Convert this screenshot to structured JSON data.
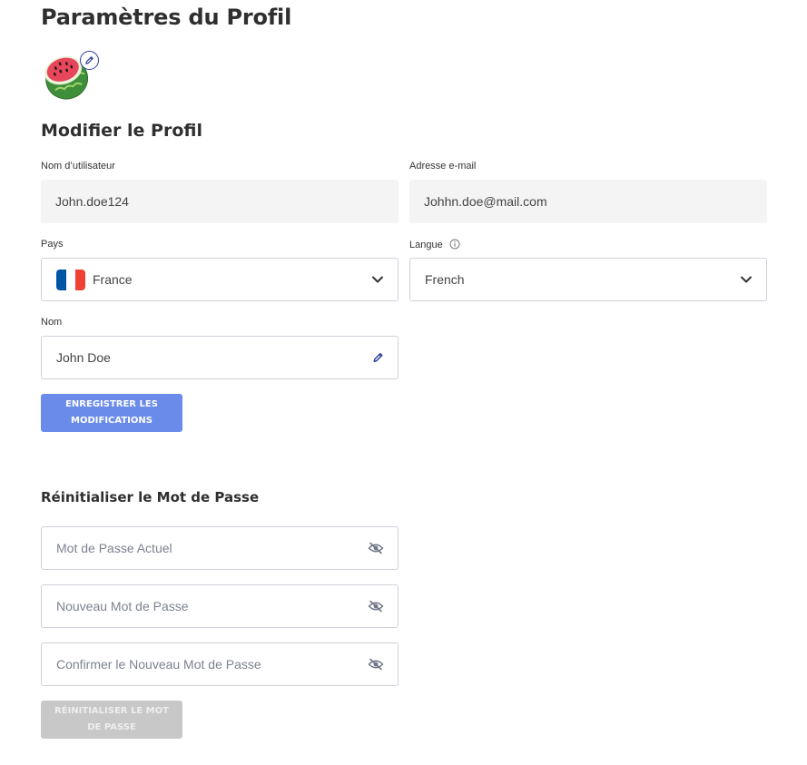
{
  "page": {
    "title": "Paramètres du Profil"
  },
  "profile": {
    "section_title": "Modifier le Profil",
    "username": {
      "label": "Nom d’utilisateur",
      "value": "John.doe124"
    },
    "email": {
      "label": "Adresse e-mail",
      "value": "Johhn.doe@mail.com"
    },
    "country": {
      "label": "Pays",
      "value": "France",
      "flag": [
        "#0055a4",
        "#ffffff",
        "#ef4135"
      ]
    },
    "language": {
      "label": "Langue",
      "value": "French"
    },
    "name": {
      "label": "Nom",
      "value": "John Doe"
    },
    "save_button": "Enregistrer les modifications"
  },
  "password": {
    "section_title": "Réinitialiser le Mot de Passe",
    "current_placeholder": "Mot de Passe Actuel",
    "new_placeholder": "Nouveau Mot de Passe",
    "confirm_placeholder": "Confirmer le Nouveau Mot de Passe",
    "reset_button": "Réinitialiser le mot de passe"
  },
  "icons": {
    "avatar": "watermelon-avatar",
    "avatar_edit": "pencil-icon",
    "dropdown": "chevron-down-icon",
    "name_edit": "pencil-icon",
    "password_toggle": "eye-off-icon",
    "language_info": "info-icon"
  },
  "colors": {
    "primary_button": "#6a8bea",
    "disabled_button": "#c8c8c8",
    "accent_icon": "#2c3e9a"
  }
}
